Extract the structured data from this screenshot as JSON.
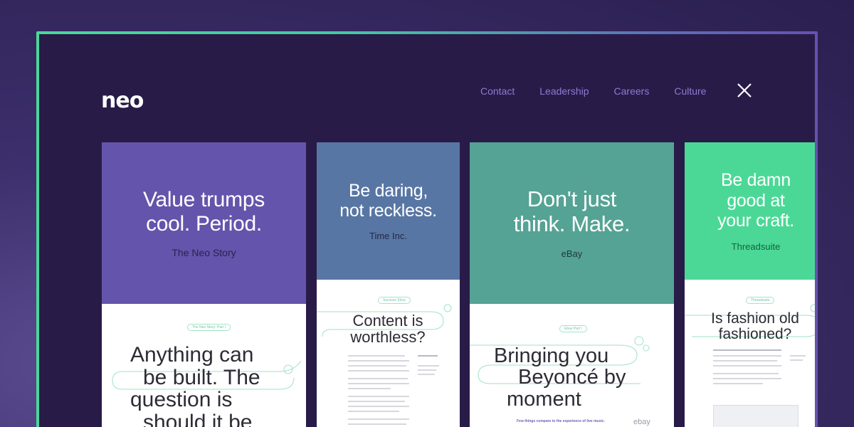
{
  "brand": {
    "logo": "neo"
  },
  "nav": {
    "items": [
      "Contact",
      "Leadership",
      "Careers",
      "Culture"
    ],
    "close_icon": "close-icon"
  },
  "colors": {
    "purple_card": "#6554ab",
    "blue_card": "#5876a3",
    "teal_card": "#55a394",
    "green_card": "#4bd896",
    "frame_bg": "#291b48",
    "nav_link": "#8c7bd0"
  },
  "cards": [
    {
      "headline_line1": "Value trumps",
      "headline_line2": "cool. Period.",
      "client": "The Neo Story",
      "tag": "The Neo Story: Part I",
      "article_line1": "Anything can",
      "article_line2": "be built. The",
      "article_line3": "question is",
      "article_line4": "should it be"
    },
    {
      "headline_line1": "Be daring,",
      "headline_line2": "not reckless.",
      "client": "Time Inc.",
      "tag": "Success Story",
      "article_line1": "Content is",
      "article_line2": "worthless?"
    },
    {
      "headline_line1": "Don't just",
      "headline_line2": "think. Make.",
      "client": "eBay",
      "tag": "Ebay Part I",
      "article_line1": "Bringing you",
      "article_line2": "Beyoncé by",
      "article_line3": "moment",
      "footer_text": "Few things compare to the experience of live music.",
      "footer_logo": "ebay"
    },
    {
      "headline_line1": "Be damn",
      "headline_line2": "good at",
      "headline_line3": "your craft.",
      "client": "Threadsuite",
      "tag": "Threadsuite",
      "article_line1": "Is fashion old",
      "article_line2": "fashioned?"
    }
  ]
}
